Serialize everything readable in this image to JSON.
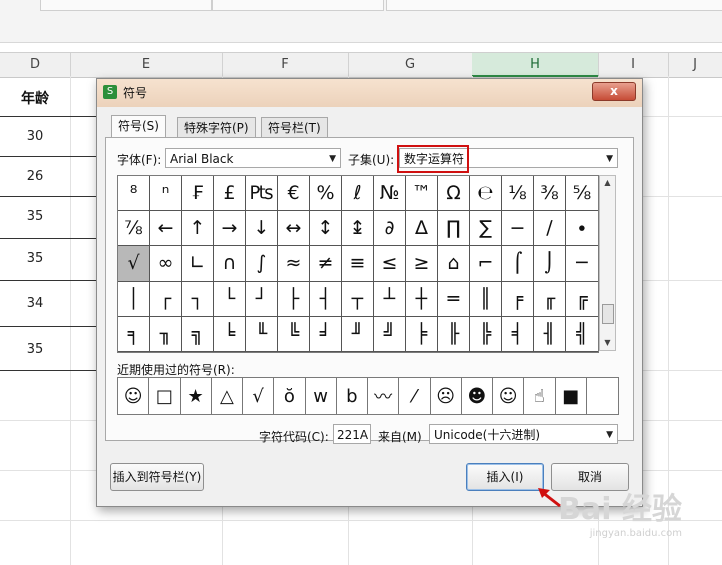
{
  "spreadsheet": {
    "columns": [
      "D",
      "E",
      "F",
      "G",
      "H",
      "I",
      "J"
    ],
    "selected_column": "H",
    "header_cell": "年龄",
    "ages": [
      "30",
      "26",
      "35",
      "35",
      "34",
      "35"
    ]
  },
  "dialog": {
    "title": "符号",
    "close_label": "x",
    "tabs": [
      {
        "label": "符号(S)",
        "active": true
      },
      {
        "label": "特殊字符(P)",
        "active": false
      },
      {
        "label": "符号栏(T)",
        "active": false
      }
    ],
    "font_label": "字体(F):",
    "font_value": "Arial Black",
    "subset_label": "子集(U):",
    "subset_value": "数字运算符",
    "symbols": [
      [
        "⁸",
        "ⁿ",
        "₣",
        "£",
        "₧",
        "€",
        "%",
        "ℓ",
        "№",
        "™",
        "Ω",
        "℮",
        "⅛",
        "⅜",
        "⅝"
      ],
      [
        "⅞",
        "←",
        "↑",
        "→",
        "↓",
        "↔",
        "↕",
        "↨",
        "∂",
        "∆",
        "∏",
        "∑",
        "−",
        "∕",
        "∙"
      ],
      [
        "√",
        "∞",
        "∟",
        "∩",
        "∫",
        "≈",
        "≠",
        "≡",
        "≤",
        "≥",
        "⌂",
        "⌐",
        "⌠",
        "⌡",
        "─"
      ],
      [
        "│",
        "┌",
        "┐",
        "└",
        "┘",
        "├",
        "┤",
        "┬",
        "┴",
        "┼",
        "═",
        "║",
        "╒",
        "╓",
        "╔"
      ],
      [
        "╕",
        "╖",
        "╗",
        "╘",
        "╙",
        "╚",
        "╛",
        "╜",
        "╝",
        "╞",
        "╟",
        "╠",
        "╡",
        "╢",
        "╣"
      ]
    ],
    "selected_symbol": "√",
    "recent_label": "近期使用过的符号(R):",
    "recent_symbols": [
      "☺",
      "□",
      "★",
      "△",
      "√",
      "ŏ",
      "w",
      "b",
      "〰",
      "⁄",
      "☹",
      "☻",
      "☺",
      "☝",
      "■",
      ""
    ],
    "charcode_label": "字符代码(C):",
    "charcode_value": "221A",
    "from_label": "来自(M)",
    "from_value": "Unicode(十六进制)",
    "insert_to_bar_label": "插入到符号栏(Y)",
    "insert_label": "插入(I)",
    "cancel_label": "取消"
  },
  "watermark": {
    "text": "Bai 经验",
    "sub": "jingyan.baidu.com"
  },
  "colors": {
    "highlight_red": "#d01010",
    "selected_col": "#2e8b46"
  }
}
